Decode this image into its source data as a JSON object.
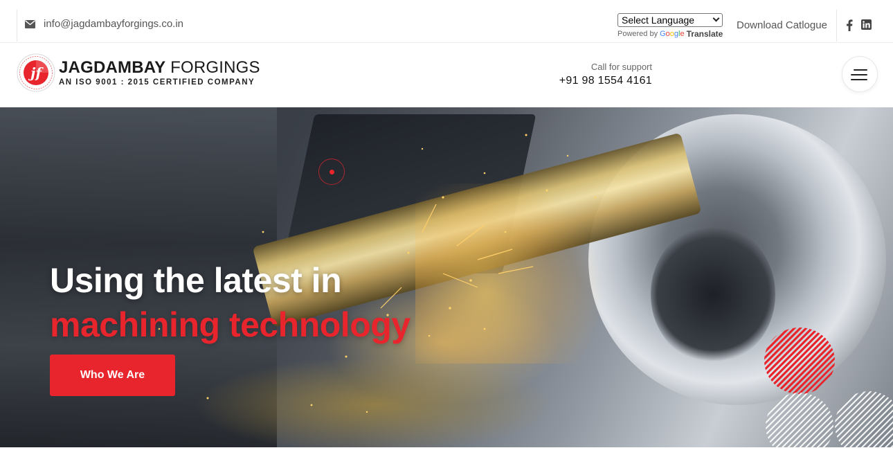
{
  "topbar": {
    "email": "info@jagdambayforgings.co.in",
    "language": {
      "selected": "Select Language",
      "powered_by": "Powered by",
      "google": "Google",
      "translate": "Translate"
    },
    "download_catalogue": "Download Catlogue",
    "social": [
      "facebook-icon",
      "linkedin-icon"
    ]
  },
  "header": {
    "logo": {
      "brand_bold": "JAGDAMBAY",
      "brand_light": "FORGINGS",
      "tagline": "AN ISO 9001 : 2015 CERTIFIED COMPANY",
      "seal_text": "JAGDAMBAY FORGINGS · SINCE 1996"
    },
    "support_label": "Call for support",
    "support_phone": "+91 98 1554 4161"
  },
  "hero": {
    "title_line1": "Using the latest in",
    "title_line2": "machining technology",
    "cta": "Who We Are"
  },
  "colors": {
    "accent": "#e8252d",
    "text_dark": "#222222",
    "text_muted": "#555555"
  }
}
